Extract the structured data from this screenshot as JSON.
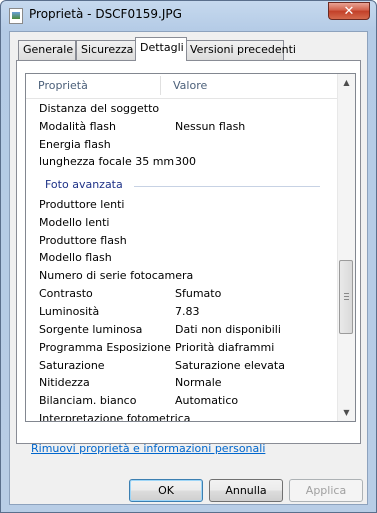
{
  "window": {
    "title": "Proprietà - DSCF0159.JPG",
    "close_label": "✕"
  },
  "tabs": [
    {
      "label": "Generale",
      "active": false
    },
    {
      "label": "Sicurezza",
      "active": false
    },
    {
      "label": "Dettagli",
      "active": true
    },
    {
      "label": "Versioni precedenti",
      "active": false
    }
  ],
  "list": {
    "columns": {
      "property": "Proprietà",
      "value": "Valore"
    },
    "rows": [
      {
        "property": "Distanza del soggetto",
        "value": ""
      },
      {
        "property": "Modalità flash",
        "value": "Nessun flash"
      },
      {
        "property": "Energia flash",
        "value": ""
      },
      {
        "property": "lunghezza focale 35 mm",
        "value": "300"
      }
    ],
    "group_label": "Foto avanzata",
    "group_rows": [
      {
        "property": "Produttore lenti",
        "value": ""
      },
      {
        "property": "Modello lenti",
        "value": ""
      },
      {
        "property": "Produttore flash",
        "value": ""
      },
      {
        "property": "Modello flash",
        "value": ""
      },
      {
        "property": "Numero di serie fotocamera",
        "value": ""
      },
      {
        "property": "Contrasto",
        "value": "Sfumato"
      },
      {
        "property": "Luminosità",
        "value": "7.83"
      },
      {
        "property": "Sorgente luminosa",
        "value": "Dati non disponibili"
      },
      {
        "property": "Programma Esposizione",
        "value": "Priorità diaframmi"
      },
      {
        "property": "Saturazione",
        "value": "Saturazione elevata"
      },
      {
        "property": "Nitidezza",
        "value": "Normale"
      },
      {
        "property": "Bilanciam. bianco",
        "value": "Automatico"
      },
      {
        "property": "Interpretazione fotometrica",
        "value": ""
      }
    ],
    "scroll_up_icon": "▲",
    "scroll_down_icon": "▼"
  },
  "link_text": "Rimuovi proprietà e informazioni personali",
  "buttons": {
    "ok": "OK",
    "cancel": "Annulla",
    "apply": "Applica"
  },
  "colors": {
    "link": "#0066cc",
    "group_header": "#1e3287",
    "title_bar": "#b9cee7"
  }
}
